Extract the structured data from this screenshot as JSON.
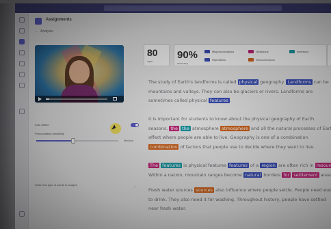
{
  "app": {
    "title": "Assignments",
    "back_label": "Analysis"
  },
  "video": {
    "progress_fraction": 0.06
  },
  "settings": {
    "auto_detect_label": "Auto detect",
    "pronunciation_label": "Pronunciation sensitivity",
    "pronunciation_value": "Medium",
    "pronunciation_level": 0.45,
    "words_label": "Select the type of words to analyze"
  },
  "stats": {
    "wpm_value": "80",
    "wpm_unit": "wpm",
    "accuracy_value": "90%",
    "accuracy_label": "accuracy"
  },
  "legend": [
    {
      "label": "Mispronunciations",
      "color": "#3b4fb8"
    },
    {
      "label": "Repetitions",
      "color": "#3b4fb8"
    },
    {
      "label": "Omissions",
      "color": "#c2287a"
    },
    {
      "label": "Self-corrections",
      "color": "#d2661e"
    },
    {
      "label": "Insertions",
      "color": "#1e9aa6"
    }
  ],
  "passage": {
    "p1": {
      "l1a": "The study of Earth's landforms is called ",
      "l1h1": "physical",
      "l1b": " geography. ",
      "l1h2": "Landforms",
      "l1c": " can be",
      "l2": "mountains and valleys. They can also be glaciers or rivers. Landforms are",
      "l3a": "sometimes called physical ",
      "l3h": "features",
      "l3b": "."
    },
    "p2": {
      "l1": "It is important for students to know about the physical geography of Earth.",
      "l2a": "seasons, ",
      "l2h1": "the",
      "l2h2": "the",
      "l2b": " atmosphere ",
      "l2h3": "atmosphere",
      "l2c": " and all the natural processes of Earth",
      "l3": "affect where people are able to live. Geography is one of a combination",
      "l4h": "combination",
      "l4b": " of factors that people use to decide where they want to live."
    },
    "p3": {
      "l1h1": "The",
      "l1h2": "features",
      "l1a": " is physical features ",
      "l1h3": "features",
      "l1b": " of a ",
      "l1h4": "region",
      "l1c": " are often rich in ",
      "l1h5": "resources",
      "l2a": "Within a nation, mountain ranges become ",
      "l2h1": "natural",
      "l2b": " borders ",
      "l2h2": "for",
      "l2h3": "settlement",
      "l2c": " areas."
    },
    "p4": {
      "l1a": "Fresh water sources ",
      "l1h": "sources",
      "l1b": " also influence where people settle. People need water",
      "l2": "to drink. They also need it for washing. Throughout history, people have settled",
      "l3": "near fresh water."
    }
  }
}
